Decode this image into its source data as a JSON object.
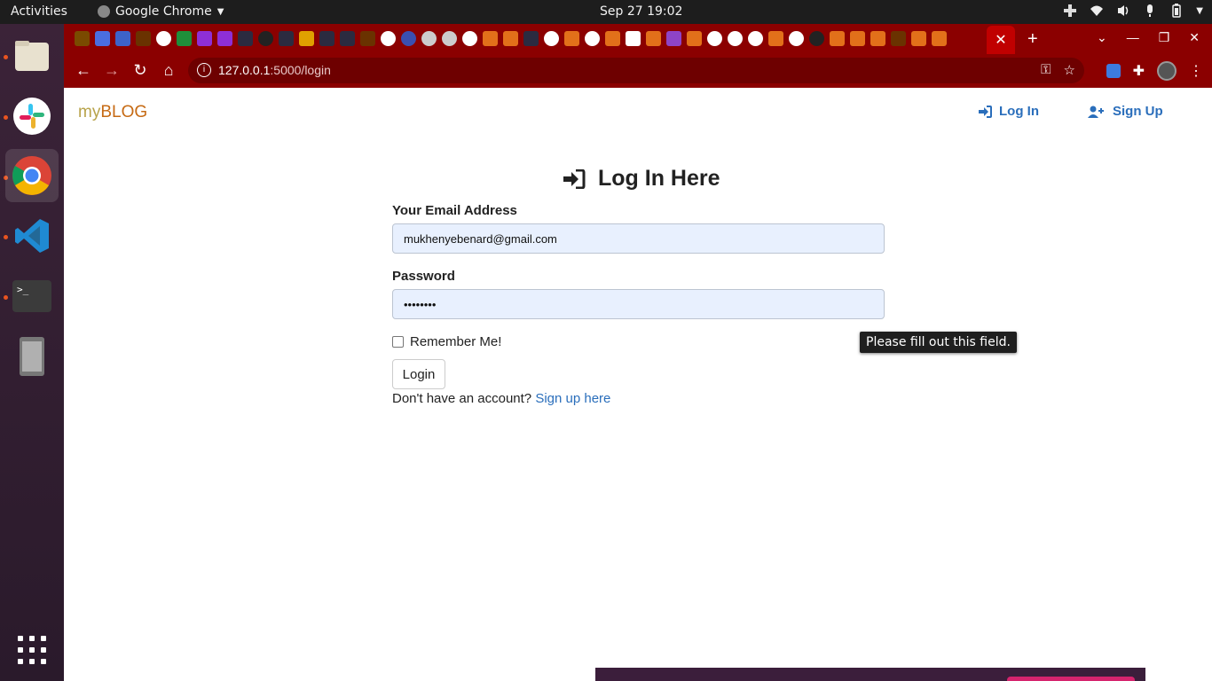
{
  "topbar": {
    "activities": "Activities",
    "app_name": "Google Chrome",
    "clock": "Sep 27  19:02"
  },
  "dock": {
    "items": [
      "files-icon",
      "slack-icon",
      "chrome-icon",
      "vscode-icon",
      "terminal-icon",
      "device-icon"
    ]
  },
  "browser": {
    "url_host": "127.0.0.1",
    "url_path": ":5000/login"
  },
  "site": {
    "brand_my": "my",
    "brand_blog": "BLOG",
    "nav_login": "Log In",
    "nav_signup": "Sign Up"
  },
  "form": {
    "title": "Log In Here",
    "email_label": "Your Email Address",
    "email_value": "mukhenyebenard@gmail.com",
    "password_label": "Password",
    "password_value": "••••••••",
    "remember_label": "Remember Me!",
    "submit_label": "Login",
    "signup_prompt": "Don't have an account? ",
    "signup_link": "Sign up here"
  },
  "tooltip": "Please fill out this field.",
  "colors": {
    "chrome_frame": "#8b0000",
    "link": "#2a6ebb",
    "brand_my": "#b8a34a",
    "brand_blog": "#c66a13"
  }
}
